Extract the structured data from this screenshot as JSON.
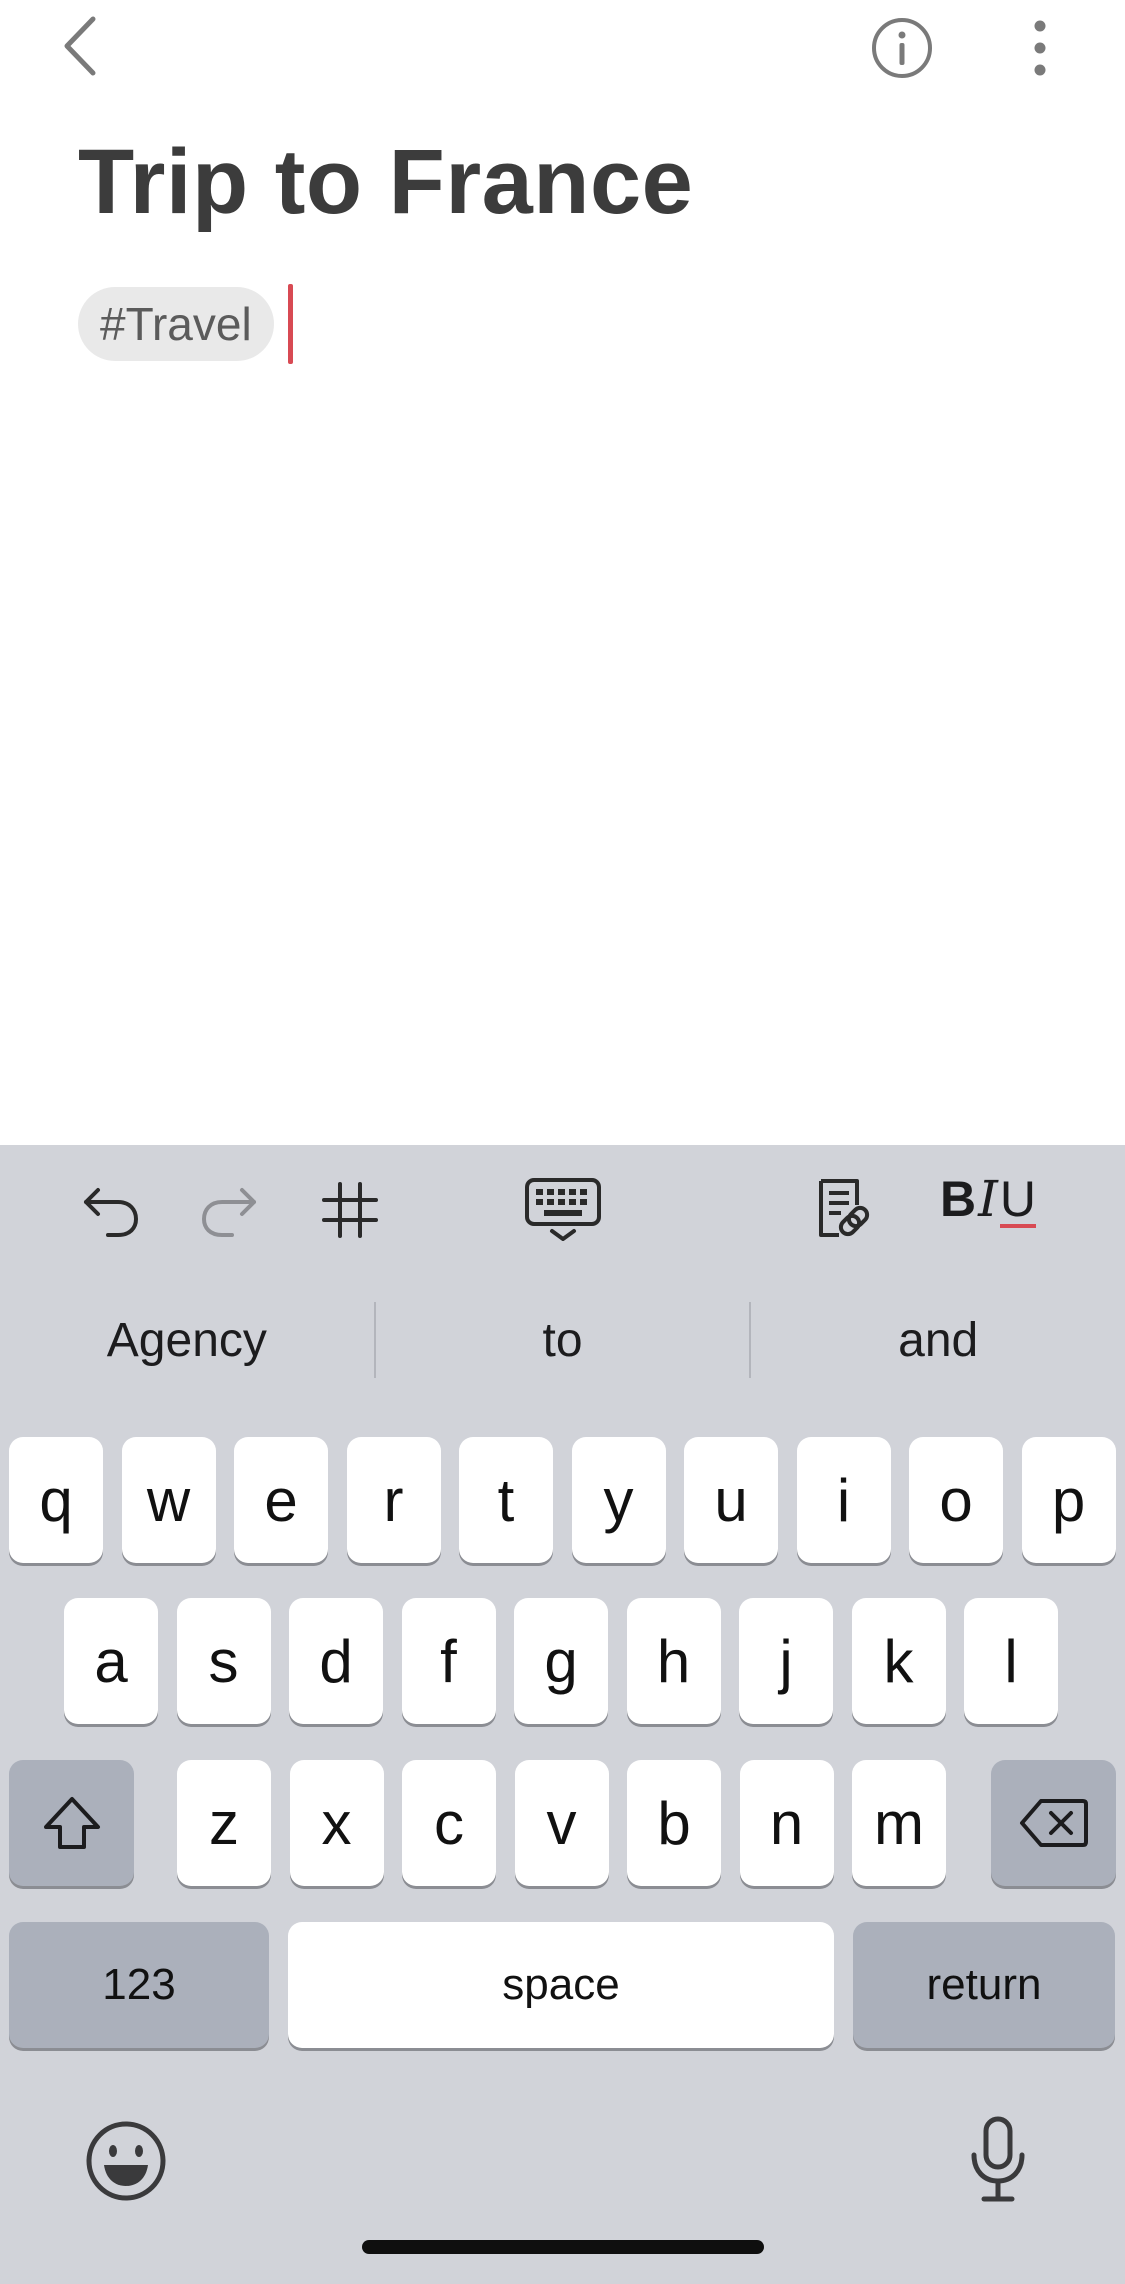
{
  "note": {
    "title": "Trip to France",
    "tag": "#Travel"
  },
  "topbar": {
    "back_icon": "chevron-left-icon",
    "info_icon": "info-circle-icon",
    "more_icon": "vertical-ellipsis-icon"
  },
  "toolbar": {
    "undo_icon": "undo-icon",
    "redo_icon": "redo-icon",
    "tag_icon": "hashtag-icon",
    "keyboard_icon": "keyboard-dismiss-icon",
    "link_note_icon": "note-link-icon",
    "format_b": "B",
    "format_i": "I",
    "format_u": "U"
  },
  "suggestions": [
    "Agency",
    "to",
    "and"
  ],
  "keyboard": {
    "row1": [
      "q",
      "w",
      "e",
      "r",
      "t",
      "y",
      "u",
      "i",
      "o",
      "p"
    ],
    "row2": [
      "a",
      "s",
      "d",
      "f",
      "g",
      "h",
      "j",
      "k",
      "l"
    ],
    "row3": [
      "z",
      "x",
      "c",
      "v",
      "b",
      "n",
      "m"
    ],
    "numbers_label": "123",
    "space_label": "space",
    "return_label": "return",
    "shift_icon": "shift-icon",
    "delete_icon": "backspace-icon",
    "emoji_icon": "emoji-icon",
    "mic_icon": "microphone-icon"
  },
  "colors": {
    "accent": "#d84a53",
    "keyboard_bg": "#d1d3d9",
    "special_key": "#abb0bb"
  }
}
